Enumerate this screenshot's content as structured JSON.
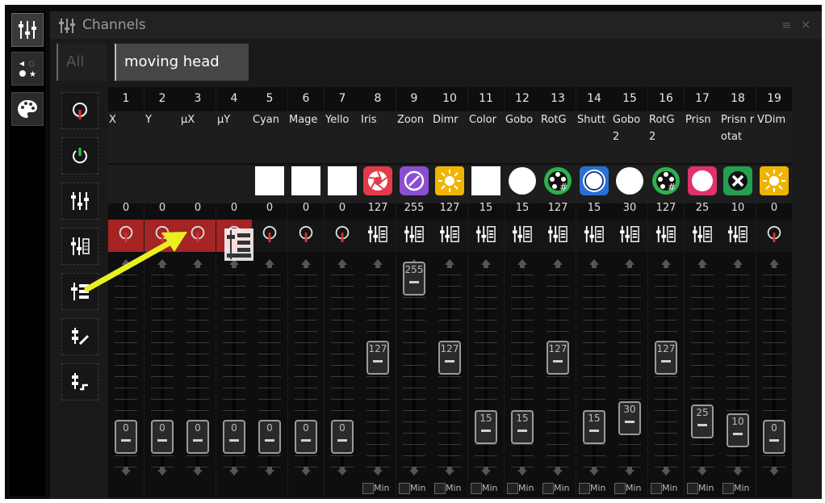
{
  "window": {
    "title": "Channels",
    "menu_icon": "hamburger-icon",
    "close_icon": "close-icon"
  },
  "side_tabs": [
    {
      "icon": "faders-icon",
      "active": true
    },
    {
      "icon": "effects-icon",
      "active": false
    },
    {
      "icon": "palette-icon",
      "active": false
    }
  ],
  "groups": [
    {
      "label": "All"
    },
    {
      "label": "moving head"
    }
  ],
  "tools": [
    {
      "icon": "position-dial-icon"
    },
    {
      "icon": "power-icon"
    },
    {
      "icon": "faders-icon"
    },
    {
      "icon": "fader-mode-icon"
    },
    {
      "icon": "fine-fader-icon"
    },
    {
      "icon": "edit-fader-icon"
    },
    {
      "icon": "step-fader-icon"
    }
  ],
  "channels": [
    {
      "num": "1",
      "label": "X",
      "value": "0",
      "mode": "dial",
      "highlight": true,
      "icon_color": "",
      "fader": 0,
      "knob_label": "0"
    },
    {
      "num": "2",
      "label": "Y",
      "value": "0",
      "mode": "dial",
      "highlight": true,
      "icon_color": "",
      "fader": 0,
      "knob_label": "0"
    },
    {
      "num": "3",
      "label": "μX",
      "value": "0",
      "mode": "dial",
      "highlight": true,
      "icon_color": "",
      "fader": 0,
      "knob_label": "0"
    },
    {
      "num": "4",
      "label": "μY",
      "value": "0",
      "mode": "dial",
      "highlight": true,
      "icon_color": "",
      "fader": 0,
      "knob_label": "0"
    },
    {
      "num": "5",
      "label": "Cyan",
      "value": "0",
      "mode": "dial",
      "highlight": false,
      "icon_color": "#ffffff",
      "icon_shape": "square",
      "fader": 0,
      "knob_label": "0"
    },
    {
      "num": "6",
      "label": "Mage",
      "value": "0",
      "mode": "dial",
      "highlight": false,
      "icon_color": "#ffffff",
      "icon_shape": "square",
      "fader": 0,
      "knob_label": "0"
    },
    {
      "num": "7",
      "label": "Yello",
      "value": "0",
      "mode": "dial",
      "highlight": false,
      "icon_color": "#ffffff",
      "icon_shape": "square",
      "fader": 0,
      "knob_label": "0"
    },
    {
      "num": "8",
      "label": "Iris",
      "value": "127",
      "mode": "fader",
      "highlight": false,
      "icon_color": "#e23a4a",
      "icon_shape": "iris",
      "fader": 127,
      "knob_label": "127"
    },
    {
      "num": "9",
      "label": "Zoon",
      "value": "255",
      "mode": "fader",
      "highlight": false,
      "icon_color": "#8a4fd1",
      "icon_shape": "zoom",
      "fader": 255,
      "knob_label": "255"
    },
    {
      "num": "10",
      "label": "Dimr",
      "value": "127",
      "mode": "fader",
      "highlight": false,
      "icon_color": "#f0b400",
      "icon_shape": "sun",
      "fader": 127,
      "knob_label": "127"
    },
    {
      "num": "11",
      "label": "Color",
      "value": "15",
      "mode": "fader",
      "highlight": false,
      "icon_color": "#ffffff",
      "icon_shape": "square",
      "fader": 15,
      "knob_label": "15"
    },
    {
      "num": "12",
      "label": "Gobo",
      "value": "15",
      "mode": "fader",
      "highlight": false,
      "icon_color": "#ffffff",
      "icon_shape": "circle",
      "fader": 15,
      "knob_label": "15"
    },
    {
      "num": "13",
      "label": "RotG",
      "value": "127",
      "mode": "fader",
      "highlight": false,
      "icon_color": "#2bb24c",
      "icon_shape": "gobo",
      "fader": 127,
      "knob_label": "127"
    },
    {
      "num": "14",
      "label": "Shutt",
      "value": "15",
      "mode": "fader",
      "highlight": false,
      "icon_color": "#2a6fd6",
      "icon_shape": "ring",
      "fader": 15,
      "knob_label": "15"
    },
    {
      "num": "15",
      "label": "Gobo 2",
      "value": "30",
      "mode": "fader",
      "highlight": false,
      "icon_color": "#ffffff",
      "icon_shape": "circle",
      "fader": 30,
      "knob_label": "30"
    },
    {
      "num": "16",
      "label": "RotG 2",
      "value": "127",
      "mode": "fader",
      "highlight": false,
      "icon_color": "#2bb24c",
      "icon_shape": "gobo",
      "fader": 127,
      "knob_label": "127"
    },
    {
      "num": "17",
      "label": "Prisn",
      "value": "25",
      "mode": "fader",
      "highlight": false,
      "icon_color": "#e0306e",
      "icon_shape": "dot",
      "fader": 25,
      "knob_label": "25"
    },
    {
      "num": "18",
      "label": "Prisn rotat",
      "value": "10",
      "mode": "fader",
      "highlight": false,
      "icon_color": "#22a050",
      "icon_shape": "x",
      "fader": 10,
      "knob_label": "10"
    },
    {
      "num": "19",
      "label": "VDim",
      "value": "0",
      "mode": "dial",
      "highlight": false,
      "icon_color": "#f0b400",
      "icon_shape": "sun",
      "fader": 0,
      "knob_label": "0"
    }
  ],
  "min_label": "Min",
  "accent": {
    "highlight_red": "#a52424",
    "arrow_yellow": "#e8f020"
  }
}
